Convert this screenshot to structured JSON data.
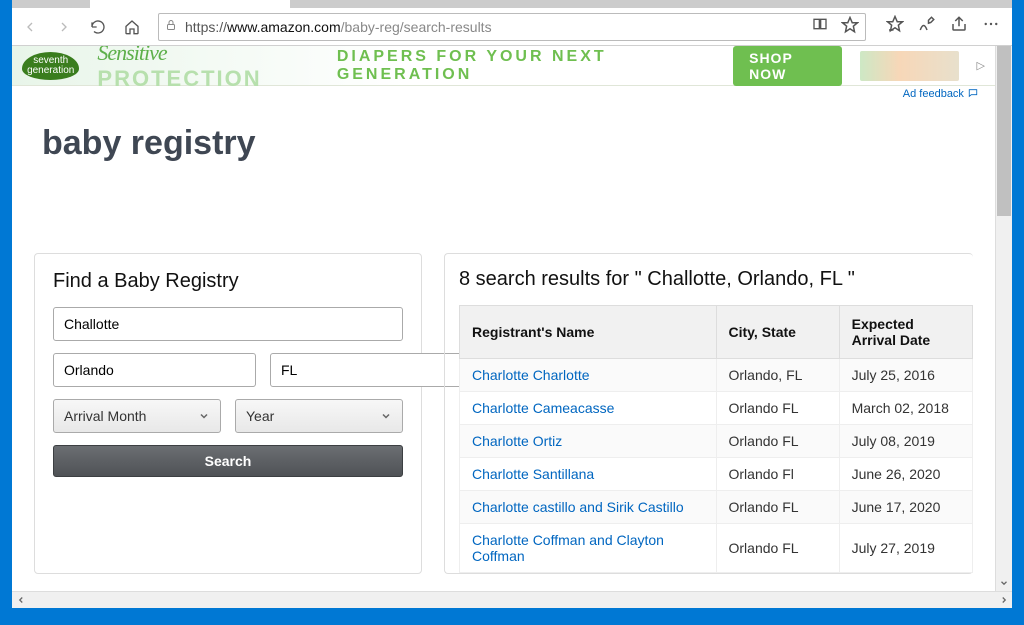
{
  "browser": {
    "url_prefix": "https://",
    "url_domain": "www.amazon.com",
    "url_path": "/baby-reg/search-results"
  },
  "ad": {
    "logo_text": "seventh generation",
    "headline_a": "Sensitive",
    "headline_b": "PROTECTION",
    "subline": "DIAPERS FOR YOUR NEXT GENERATION",
    "cta": "SHOP NOW",
    "feedback": "Ad feedback"
  },
  "page": {
    "title": "baby registry"
  },
  "search": {
    "panel_title": "Find a Baby Registry",
    "name_value": "Challotte",
    "city_value": "Orlando",
    "state_value": "FL",
    "month_label": "Arrival Month",
    "year_label": "Year",
    "button_label": "Search"
  },
  "results": {
    "prefix": "8 search results for \"",
    "query": " Challotte, Orlando, FL ",
    "suffix": "\"",
    "columns": {
      "c0": "Registrant's Name",
      "c1": "City, State",
      "c2": "Expected Arrival Date"
    },
    "rows": [
      {
        "name": "Charlotte Charlotte",
        "city": "Orlando, FL",
        "date": "July 25, 2016"
      },
      {
        "name": "Charlotte Cameacasse",
        "city": "Orlando FL",
        "date": "March 02, 2018"
      },
      {
        "name": "Charlotte Ortiz",
        "city": "Orlando FL",
        "date": "July 08, 2019"
      },
      {
        "name": "Charlotte Santillana",
        "city": "Orlando Fl",
        "date": "June 26, 2020"
      },
      {
        "name": "Charlotte castillo and Sirik Castillo",
        "city": "Orlando FL",
        "date": "June 17, 2020"
      },
      {
        "name": "Charlotte Coffman and Clayton Coffman",
        "city": "Orlando FL",
        "date": "July 27, 2019"
      }
    ]
  }
}
